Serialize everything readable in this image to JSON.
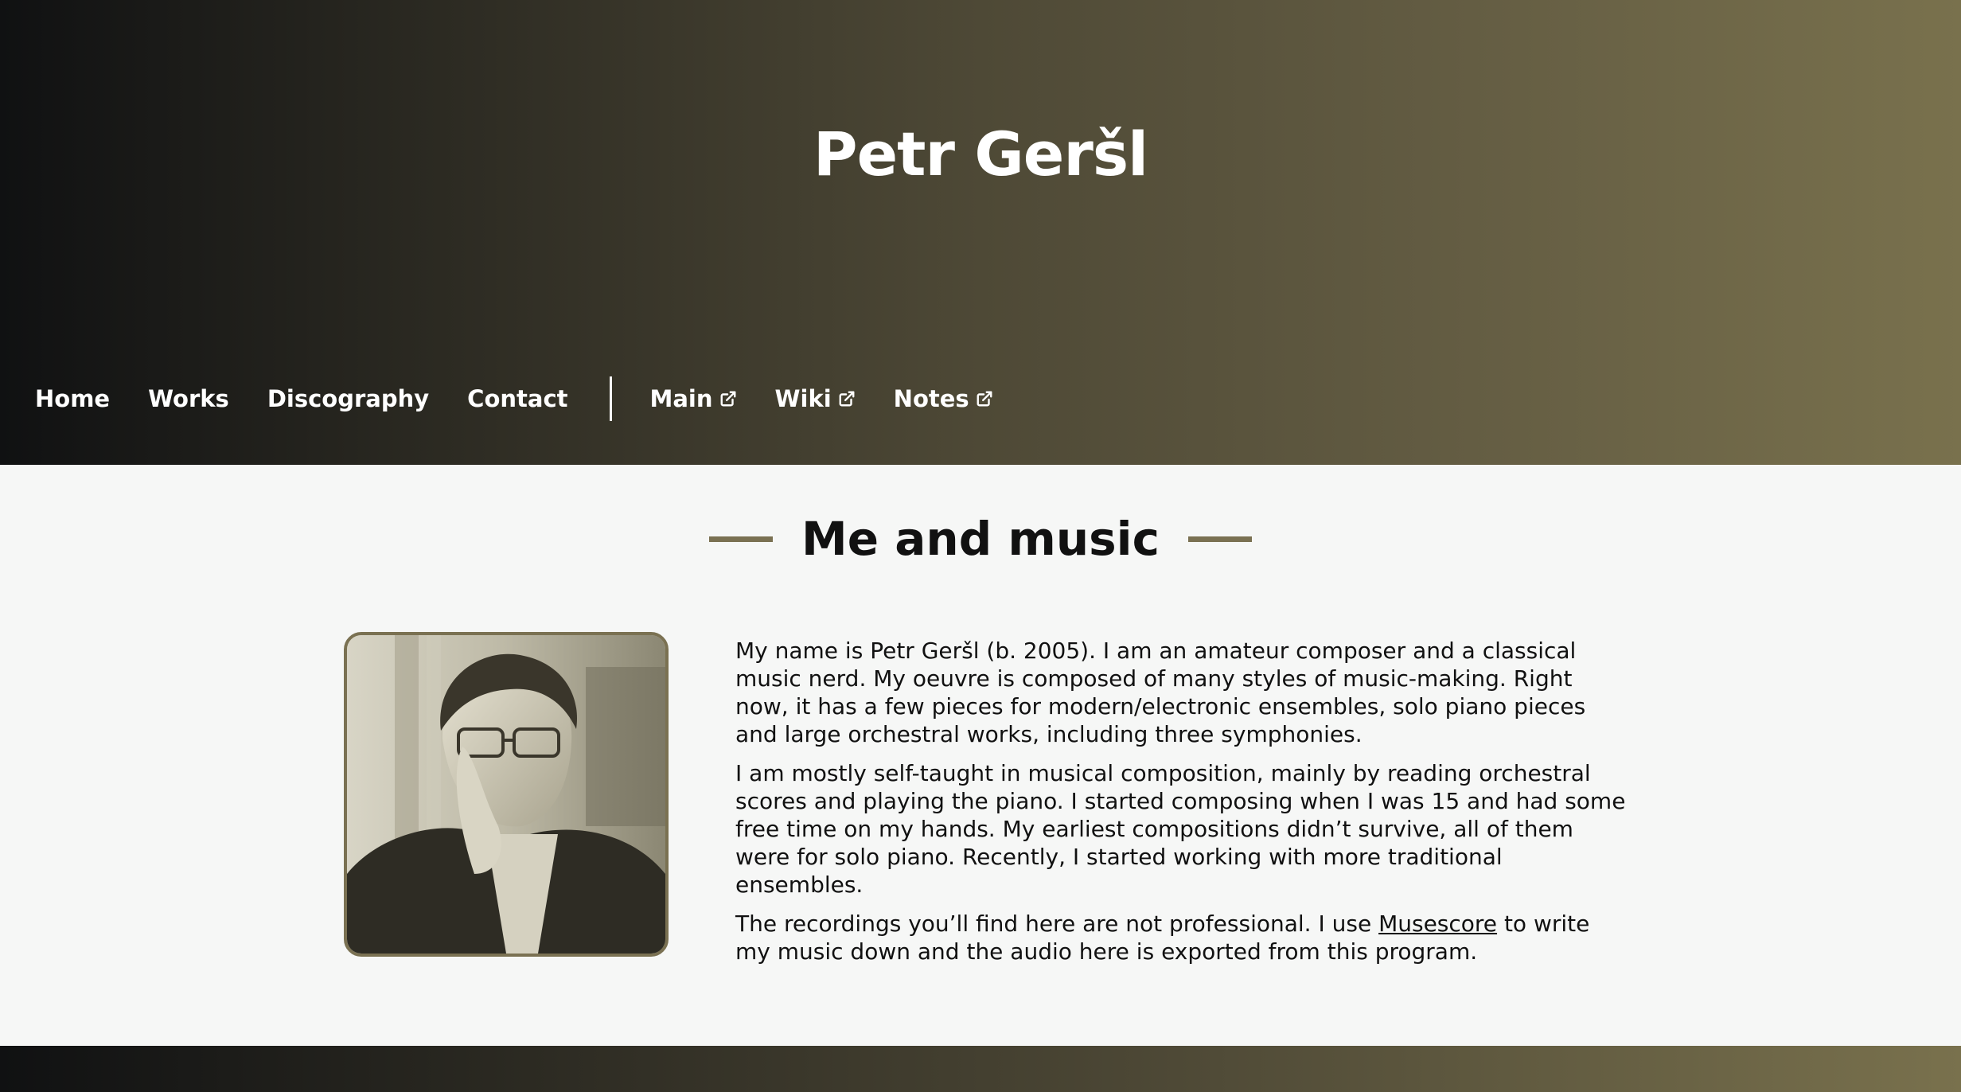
{
  "header": {
    "title": "Petr Geršl"
  },
  "nav": {
    "items": [
      {
        "label": "Home"
      },
      {
        "label": "Works"
      },
      {
        "label": "Discography"
      },
      {
        "label": "Contact"
      }
    ],
    "external": [
      {
        "label": "Main",
        "icon": "external-link-icon"
      },
      {
        "label": "Wiki",
        "icon": "external-link-icon"
      },
      {
        "label": "Notes",
        "icon": "external-link-icon"
      }
    ]
  },
  "main": {
    "section_title": "Me and music",
    "portrait_icon": "portrait-photo",
    "paragraphs": {
      "p1": "My name is Petr Geršl (b. 2005). I am an amateur composer and a classical music nerd. My oeuvre is composed of many styles of music-making. Right now, it has a few pieces for modern/electronic ensembles, solo piano pieces and large orchestral works, including three symphonies.",
      "p2": "I am mostly self-taught in musical composition, mainly by reading orchestral scores and playing the piano. I started composing when I was 15 and had some free time on my hands. My earliest compositions didn’t survive, all of them were for solo piano. Recently, I started working with more traditional ensembles.",
      "p3_before": "The recordings you’ll find here are not professional. I use ",
      "p3_link": "Musescore",
      "p3_after": " to write my music down and the audio here is exported from this program."
    }
  },
  "colors": {
    "accent": "#7a7152",
    "header_dark": "#101112",
    "header_light": "#79714d",
    "page_bg": "#f6f7f6"
  }
}
